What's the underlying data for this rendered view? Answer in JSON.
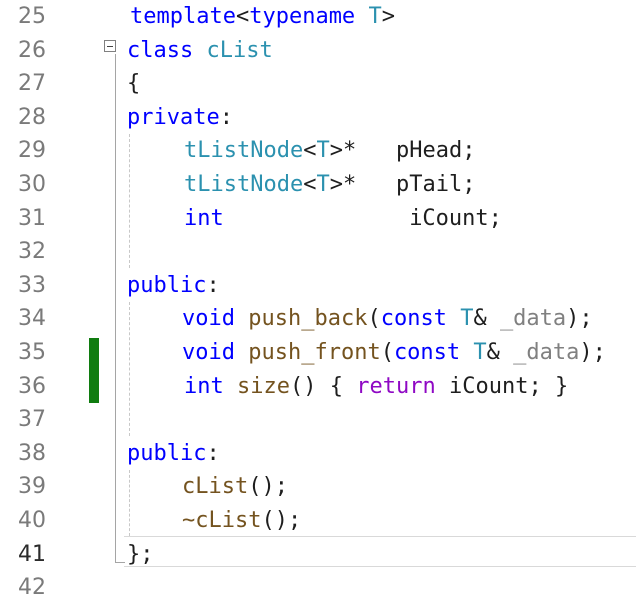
{
  "editor": {
    "line_numbers": [
      "25",
      "26",
      "27",
      "28",
      "29",
      "30",
      "31",
      "32",
      "33",
      "34",
      "35",
      "36",
      "37",
      "38",
      "39",
      "40",
      "41",
      "42"
    ],
    "current_line": "41",
    "changed_lines": [
      "35",
      "36"
    ]
  },
  "code": {
    "l25": {
      "kw1": "template",
      "p1": "<",
      "kw2": "typename",
      "sp": " ",
      "ty1": "T",
      "p2": ">"
    },
    "l26": {
      "kw1": "class",
      "sp": " ",
      "ty1": "cList"
    },
    "l27": {
      "p1": "{"
    },
    "l28": {
      "kw1": "private",
      "p1": ":"
    },
    "l29": {
      "ty1": "tListNode",
      "p1": "<",
      "ty2": "T",
      "p2": ">*",
      "sp": "   ",
      "id1": "pHead",
      "p3": ";"
    },
    "l30": {
      "ty1": "tListNode",
      "p1": "<",
      "ty2": "T",
      "p2": ">*",
      "sp": "   ",
      "id1": "pTail",
      "p3": ";"
    },
    "l31": {
      "kw1": "int",
      "sp": "              ",
      "id1": "iCount",
      "p3": ";"
    },
    "l33": {
      "kw1": "public",
      "p1": ":"
    },
    "l34": {
      "kw1": "void",
      "fn1": "push_back",
      "p1": "(",
      "kw2": "const",
      "ty1": "T",
      "p2": "&",
      "pm1": "_data",
      "p3": ");"
    },
    "l35": {
      "kw1": "void",
      "fn1": "push_front",
      "p1": "(",
      "kw2": "const",
      "ty1": "T",
      "p2": "&",
      "pm1": "_data",
      "p3": ");"
    },
    "l36": {
      "kw1": "int",
      "fn1": "size",
      "p1": "()",
      "p2": "{",
      "ctl1": "return",
      "id1": "iCount",
      "p3": ";",
      "p4": "}"
    },
    "l38": {
      "kw1": "public",
      "p1": ":"
    },
    "l39": {
      "fn1": "cList",
      "p1": "();"
    },
    "l40": {
      "fn1": "~cList",
      "p1": "();"
    },
    "l41": {
      "p1": "};"
    }
  },
  "colors": {
    "keyword": "#0000ff",
    "type": "#2b91af",
    "function": "#74531f",
    "control": "#8f08c4",
    "param": "#808080",
    "change_bar": "#107c10"
  }
}
